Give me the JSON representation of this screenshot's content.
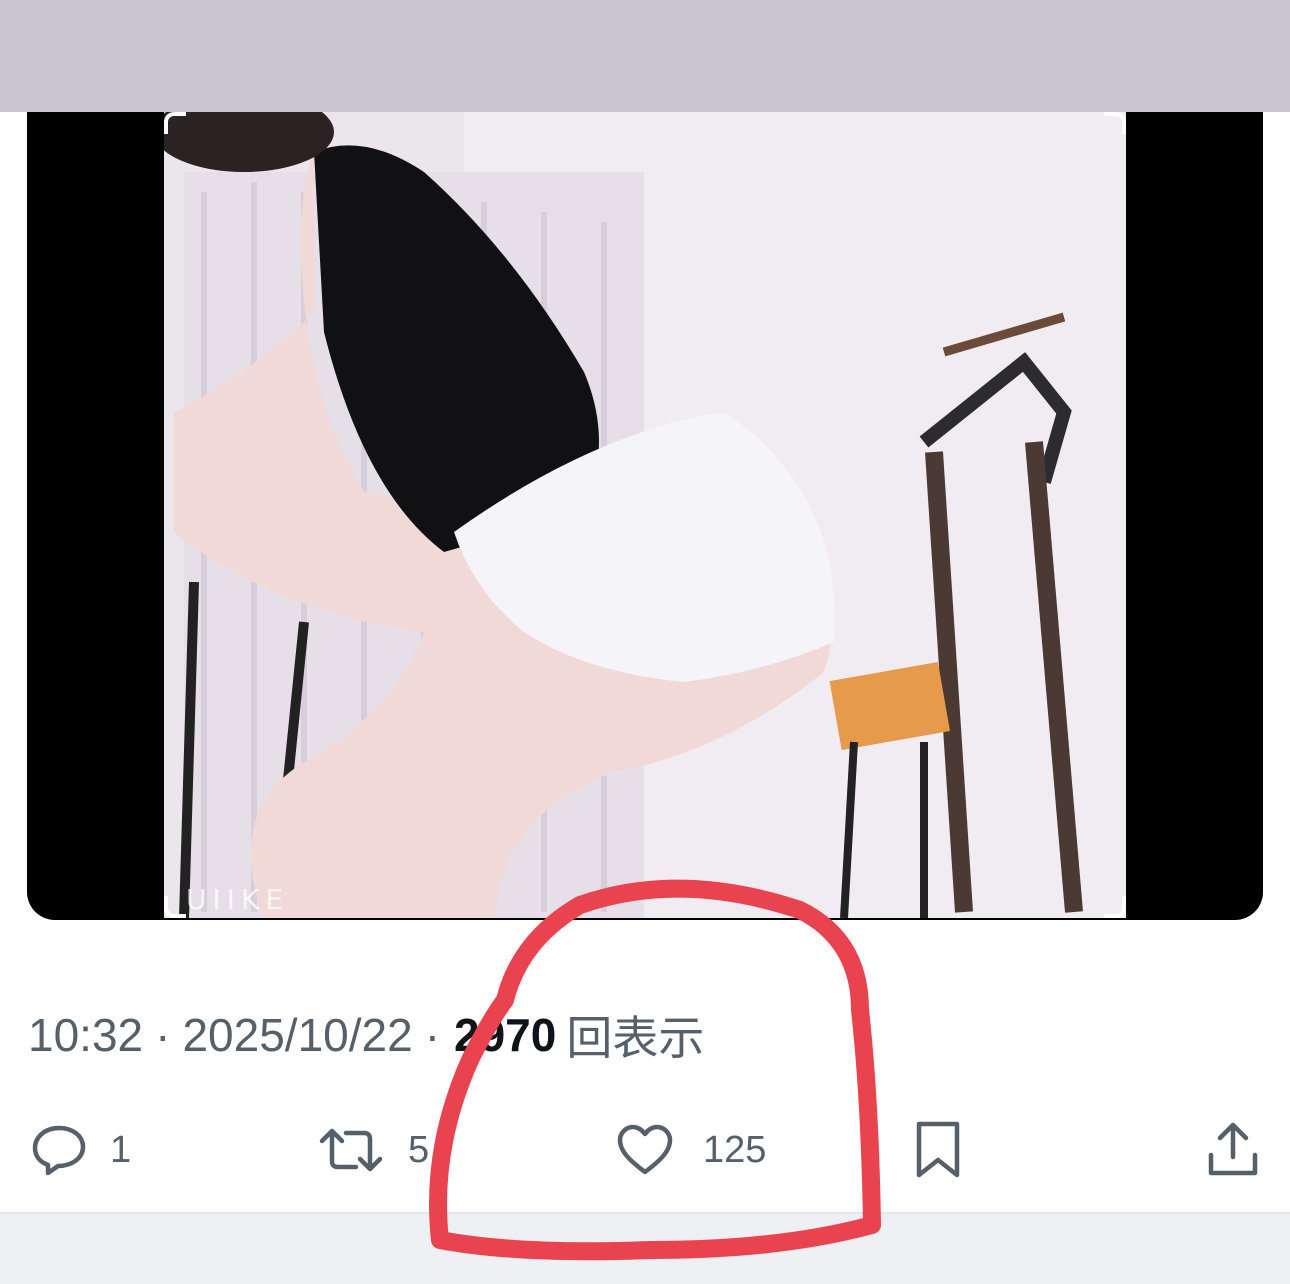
{
  "post": {
    "time": "10:32",
    "separator": "·",
    "date": "2025/10/22",
    "views_count": "2970",
    "views_label": "回表示"
  },
  "media": {
    "watermark": "UIIKE"
  },
  "actions": {
    "reply_count": "1",
    "repost_count": "5",
    "like_count": "125"
  },
  "icons": [
    "reply-icon",
    "repost-icon",
    "like-icon",
    "bookmark-icon",
    "share-icon"
  ],
  "colors": {
    "secondary_text": "#55606b",
    "primary_text": "#0f1419",
    "annotation": "#e8434f",
    "top_band": "#c9c5d3"
  }
}
